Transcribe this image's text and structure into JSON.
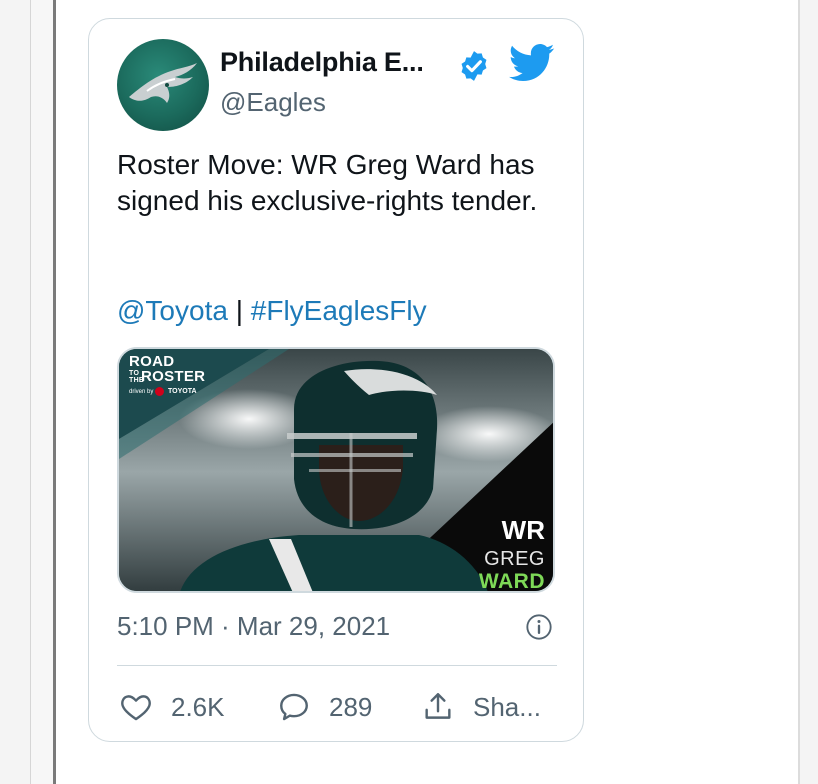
{
  "tweet": {
    "author_name": "Philadelphia E...",
    "handle": "@Eagles",
    "verified": true,
    "text": "Roster Move: WR Greg Ward has signed his exclusive-rights tender.",
    "mention": "@Toyota",
    "separator": " | ",
    "hashtag": "#FlyEaglesFly",
    "timestamp": "5:10 PM · Mar 29, 2021",
    "likes": "2.6K",
    "replies": "289",
    "share_label": "Sha..."
  },
  "media": {
    "brand_line1": "ROAD",
    "brand_tothe": "TO THE",
    "brand_line2": "ROSTER",
    "brand_driven": "driven by",
    "brand_sponsor": "TOYOTA",
    "position": "WR",
    "player_first": "GREG",
    "player_last": "WARD"
  },
  "icons": {
    "verified": "verified-badge-icon",
    "twitter": "twitter-bird-icon",
    "info": "info-icon",
    "like": "heart-icon",
    "reply": "reply-bubble-icon",
    "share": "share-upload-icon"
  },
  "colors": {
    "link": "#1d7ab8",
    "verified": "#1d9bf0",
    "twitter": "#1d9bf0",
    "secondary_text": "#536471",
    "eagles_green": "#004c54",
    "ward_green": "#7ed957"
  }
}
